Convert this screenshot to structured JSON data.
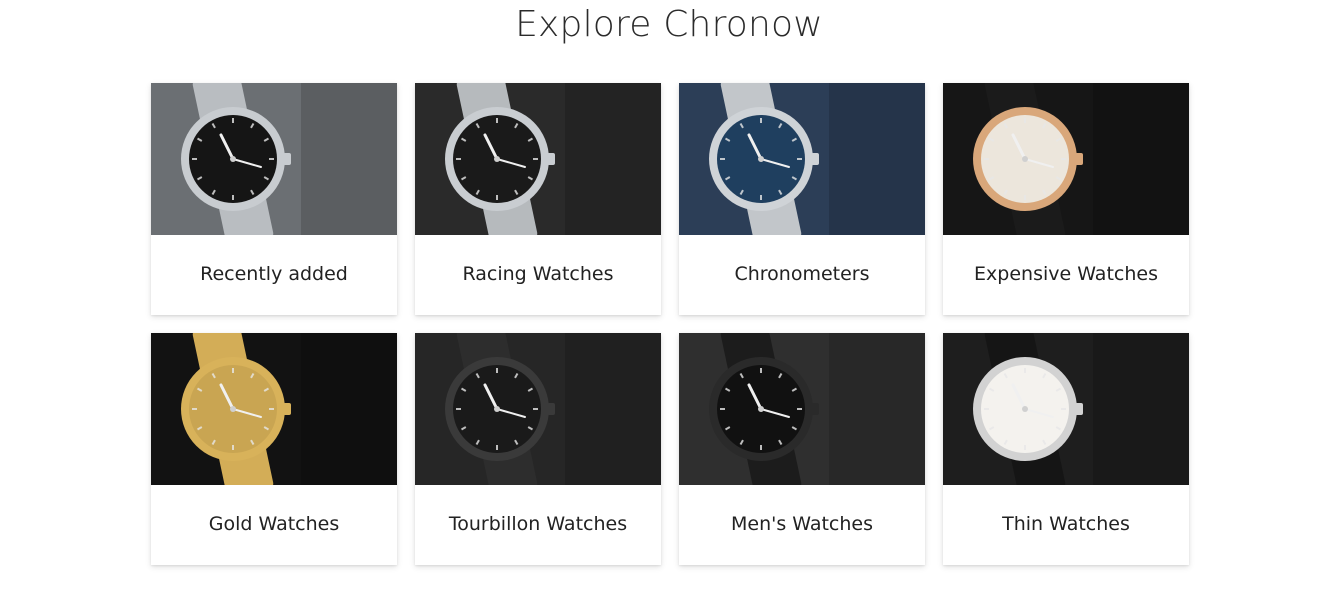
{
  "page": {
    "title": "Explore Chronow"
  },
  "categories": [
    {
      "label": "Recently added",
      "image": "silver-black-chronograph-watch-photo",
      "bg": "#6b6f73",
      "case": "#c8ccd0",
      "dial": "#151515",
      "band": "#b9bdc1"
    },
    {
      "label": "Racing Watches",
      "image": "steel-racing-chronograph-watch-photo",
      "bg": "#2a2a2a",
      "case": "#c9cdd1",
      "dial": "#1a1a1a",
      "band": "#b6babd"
    },
    {
      "label": "Chronometers",
      "image": "blue-dial-chronometer-watch-photo",
      "bg": "#2c3e57",
      "case": "#cfd3d7",
      "dial": "#1f3f5f",
      "band": "#c2c6ca"
    },
    {
      "label": "Expensive Watches",
      "image": "rose-gold-complication-watch-photo",
      "bg": "#161616",
      "case": "#d9a77a",
      "dial": "#ece6dc",
      "band": "#1b1b1b"
    },
    {
      "label": "Gold Watches",
      "image": "yellow-gold-day-date-watch-photo",
      "bg": "#121212",
      "case": "#d8b25a",
      "dial": "#c9a552",
      "band": "#d3ad57"
    },
    {
      "label": "Tourbillon Watches",
      "image": "black-skeleton-tourbillon-watch-photo",
      "bg": "#262626",
      "case": "#3a3a3a",
      "dial": "#1a1a1a",
      "band": "#2d2d2d"
    },
    {
      "label": "Men's Watches",
      "image": "black-pilot-watch-photo",
      "bg": "#2f2f2f",
      "case": "#2a2a2a",
      "dial": "#111111",
      "band": "#1c1c1c"
    },
    {
      "label": "Thin Watches",
      "image": "white-dial-dress-watch-photo",
      "bg": "#1e1e1e",
      "case": "#d2d2d2",
      "dial": "#f4f2ee",
      "band": "#151515"
    }
  ]
}
